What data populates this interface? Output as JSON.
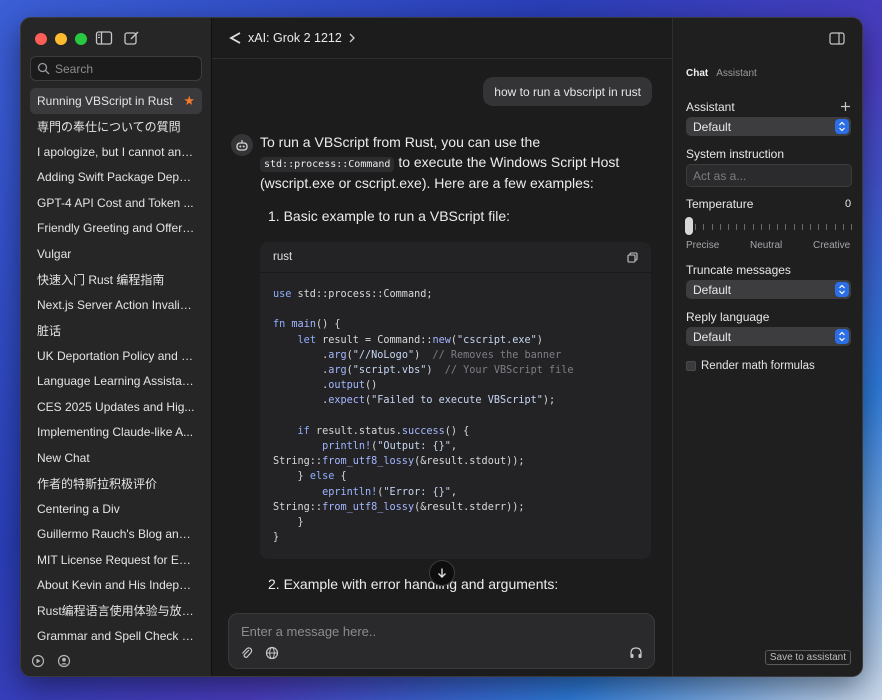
{
  "sidebar": {
    "search_placeholder": "Search",
    "items": [
      {
        "label": "Running VBScript in Rust",
        "starred": true
      },
      {
        "label": "専門の奉仕についての質問"
      },
      {
        "label": "I apologize, but I cannot and..."
      },
      {
        "label": "Adding Swift Package Depe..."
      },
      {
        "label": "GPT-4 API Cost and Token ..."
      },
      {
        "label": "Friendly Greeting and Offer ..."
      },
      {
        "label": "Vulgar"
      },
      {
        "label": "快速入门 Rust 编程指南"
      },
      {
        "label": "Next.js Server Action Invalid..."
      },
      {
        "label": "脏话"
      },
      {
        "label": "UK Deportation Policy and C..."
      },
      {
        "label": "Language Learning Assistan..."
      },
      {
        "label": "CES 2025 Updates and Hig..."
      },
      {
        "label": "Implementing Claude-like A..."
      },
      {
        "label": "New Chat"
      },
      {
        "label": "作者的特斯拉积极评价"
      },
      {
        "label": "Centering a Div"
      },
      {
        "label": "Guillermo Rauch's Blog and ..."
      },
      {
        "label": "MIT License Request for EG..."
      },
      {
        "label": "About Kevin and His Indepe..."
      },
      {
        "label": "Rust编程语言使用体验与放弃..."
      },
      {
        "label": "Grammar and Spell Check R..."
      }
    ]
  },
  "header": {
    "model": "xAI: Grok 2 1212"
  },
  "conversation": {
    "user_message": "how to run a vbscript in rust",
    "answer_part1": "To run a VBScript from Rust, you can use the",
    "answer_code": "std::process::Command",
    "answer_part2": "to execute the Windows Script Host (wscript.exe or cscript.exe). Here are a few examples:",
    "list_1": "1.  Basic example to run a VBScript file:",
    "list_2": "2.  Example with error handling and arguments:",
    "code_lang": "rust",
    "code_lines": [
      "use std::process::Command;",
      "",
      "fn main() {",
      "    let result = Command::new(\"cscript.exe\")",
      "        .arg(\"//NoLogo\")  // Removes the banner",
      "        .arg(\"script.vbs\")  // Your VBScript file",
      "        .output()",
      "        .expect(\"Failed to execute VBScript\");",
      "",
      "    if result.status.success() {",
      "        println!(\"Output: {}\",",
      "String::from_utf8_lossy(&result.stdout));",
      "    } else {",
      "        eprintln!(\"Error: {}\",",
      "String::from_utf8_lossy(&result.stderr));",
      "    }",
      "}"
    ]
  },
  "composer": {
    "placeholder": "Enter a message here.."
  },
  "right_panel": {
    "tabs": [
      "Chat",
      "Assistant"
    ],
    "assistant_label": "Assistant",
    "assistant_value": "Default",
    "system_label": "System instruction",
    "system_placeholder": "Act as a...",
    "temperature_label": "Temperature",
    "temperature_value": "0",
    "temp_labels": [
      "Precise",
      "Neutral",
      "Creative"
    ],
    "truncate_label": "Truncate messages",
    "truncate_value": "Default",
    "reply_label": "Reply language",
    "reply_value": "Default",
    "render_math_label": "Render math formulas",
    "save_label": "Save to assistant"
  },
  "colors": {
    "accent": "#2b6ee6",
    "star": "#f47a2b",
    "window_bg": "#1e1e1f"
  }
}
